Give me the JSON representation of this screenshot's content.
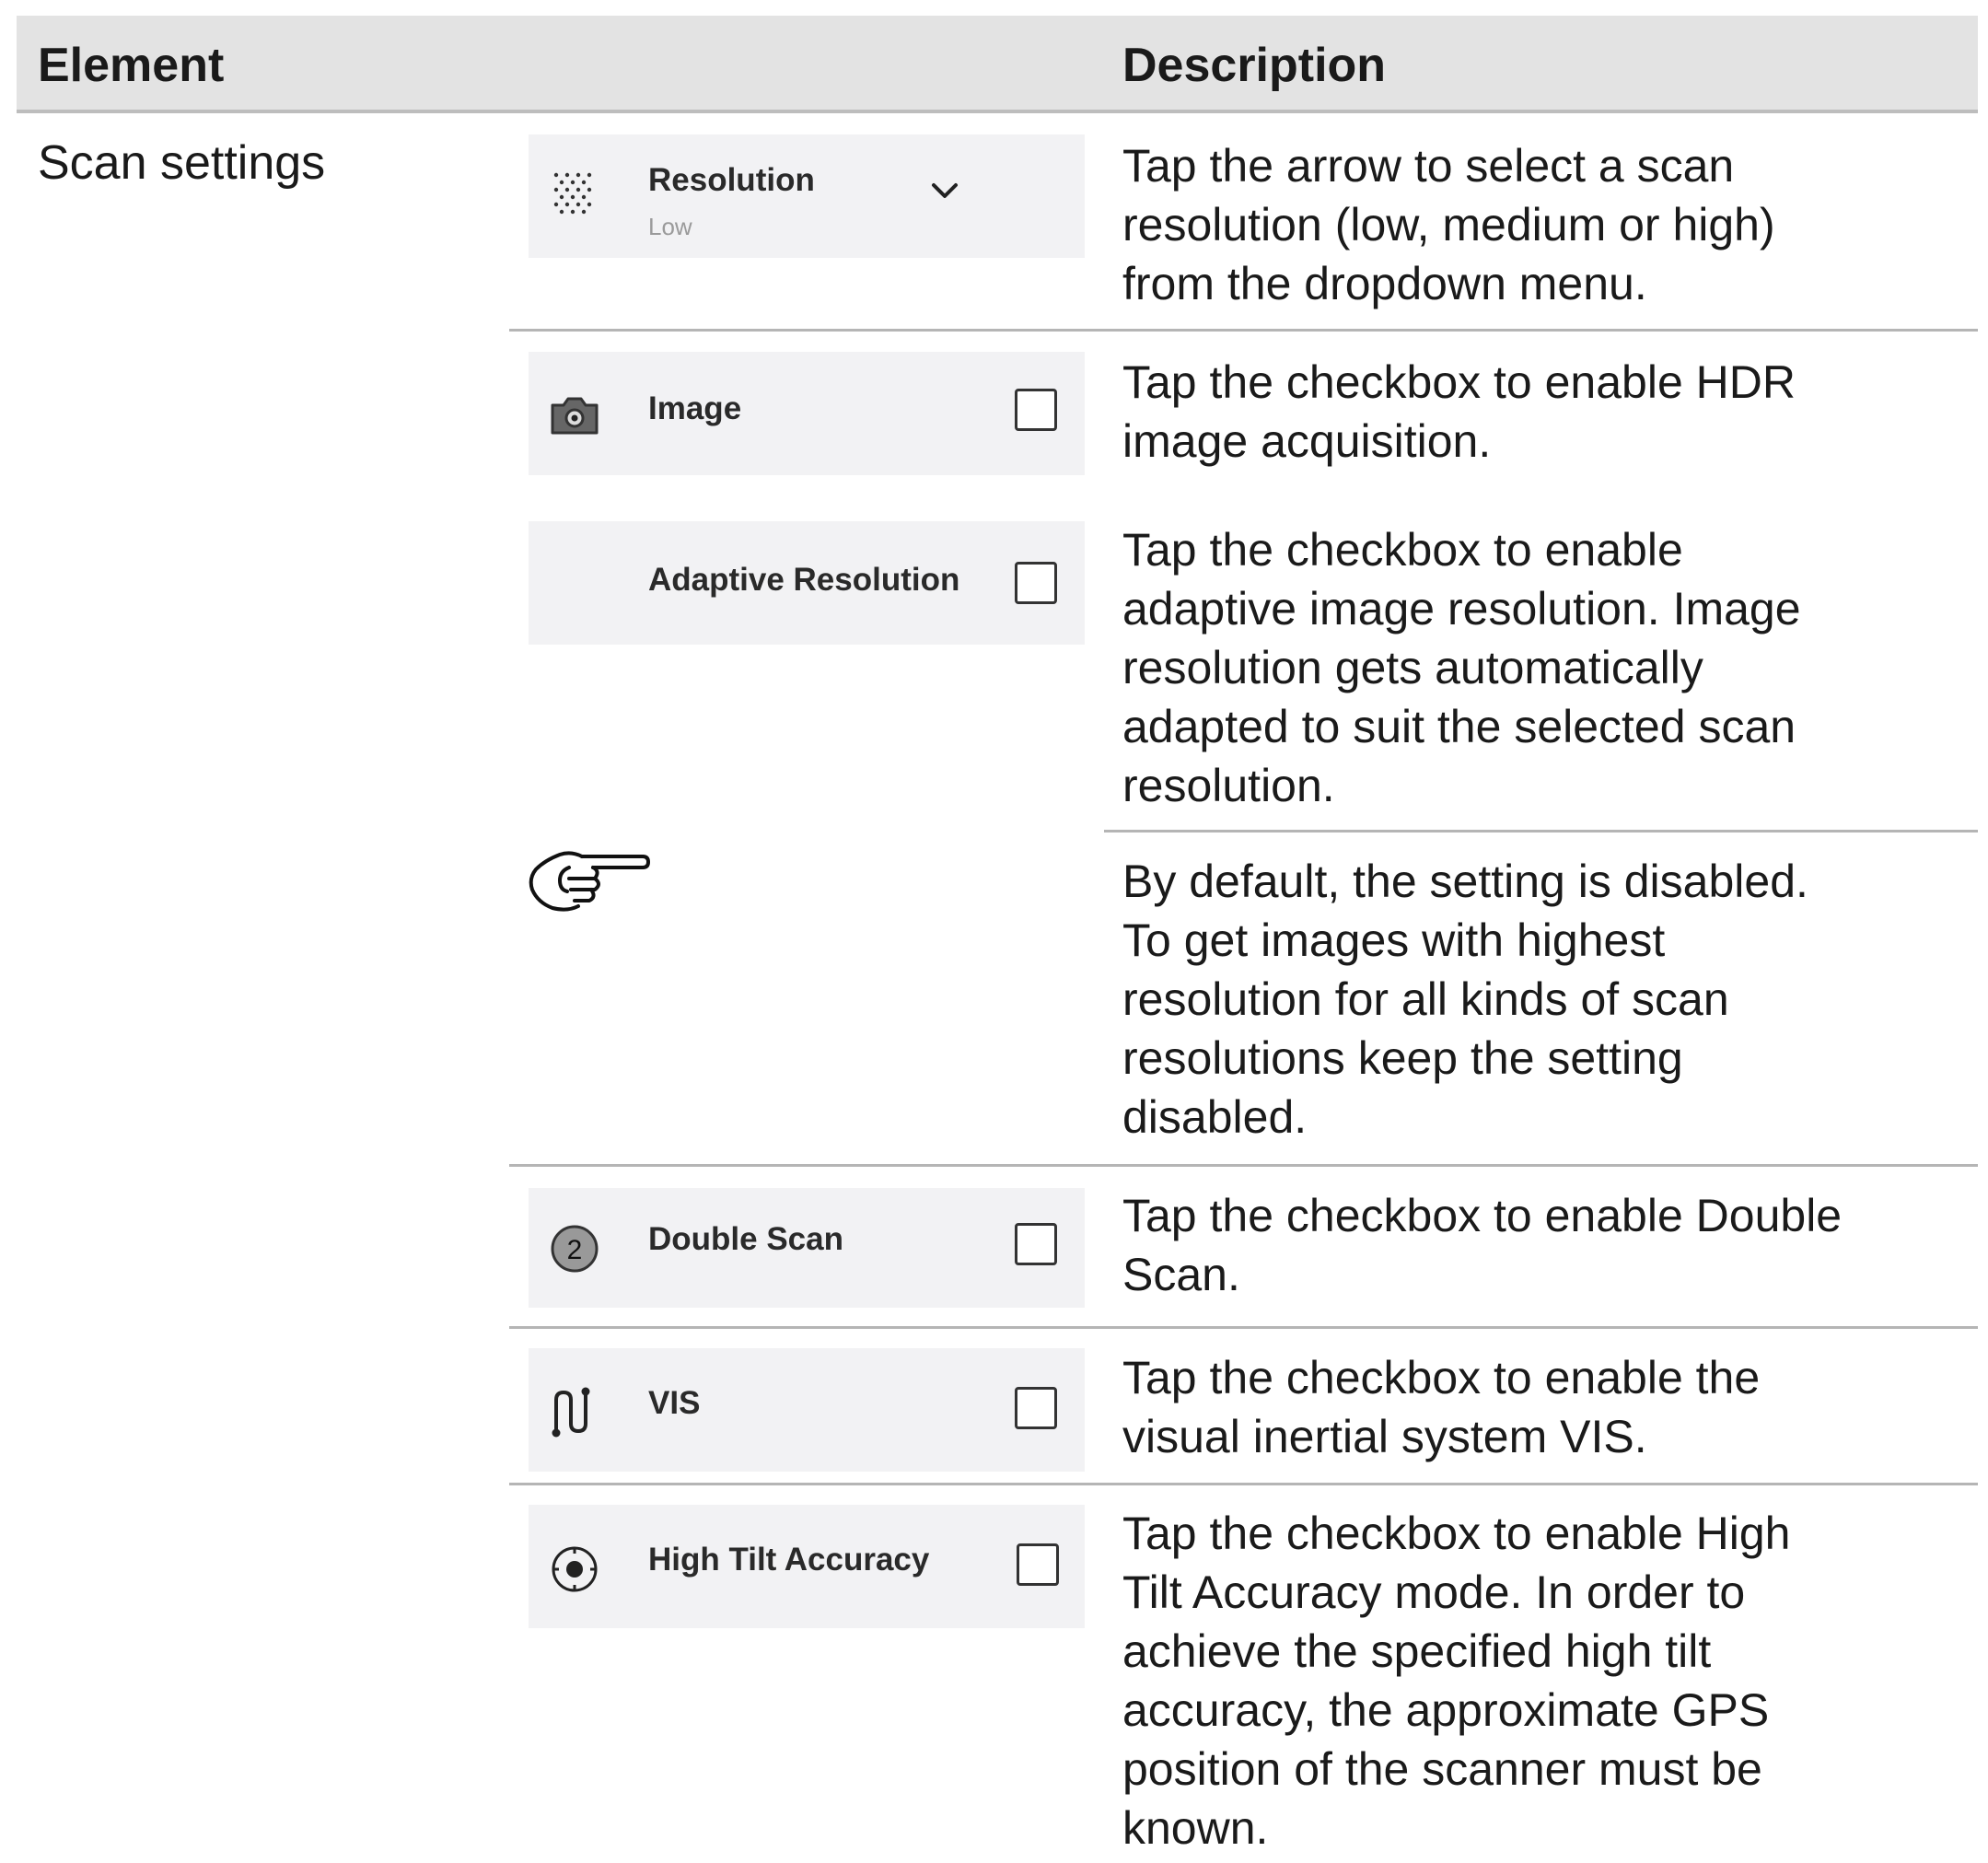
{
  "header": {
    "element": "Element",
    "description": "Description"
  },
  "group_label": "Scan settings",
  "settings": {
    "resolution": {
      "label": "Resolution",
      "value": "Low",
      "icon": "dots-grid-icon"
    },
    "image": {
      "label": "Image",
      "icon": "camera-icon"
    },
    "adaptive_resolution": {
      "label": "Adaptive Resolution"
    },
    "double_scan": {
      "label": "Double Scan",
      "icon": "number-2-circle-icon"
    },
    "vis": {
      "label": "VIS",
      "icon": "path-icon"
    },
    "high_tilt": {
      "label": "High Tilt Accuracy",
      "icon": "target-icon"
    }
  },
  "descriptions": {
    "resolution": "Tap the arrow to select a scan\nresolution (low, medium or high)\nfrom the dropdown menu.",
    "image": "Tap the checkbox to enable HDR\nimage acquisition.",
    "adaptive_resolution": "Tap the checkbox to enable\nadaptive image resolution. Image\nresolution gets automatically\nadapted to suit the selected scan\nresolution.",
    "note": "By default, the setting is disabled.\nTo get images with highest\nresolution for all kinds of scan\nresolutions keep the setting\ndisabled.",
    "double_scan": "Tap the checkbox to enable Double\nScan.",
    "vis": "Tap the checkbox to enable the\nvisual inertial system VIS.",
    "high_tilt": "Tap the checkbox to enable High\nTilt Accuracy mode. In order to\nachieve the specified high tilt\naccuracy, the approximate GPS\nposition of the scanner must be\nknown."
  },
  "note_icon": "pointing-hand-icon"
}
